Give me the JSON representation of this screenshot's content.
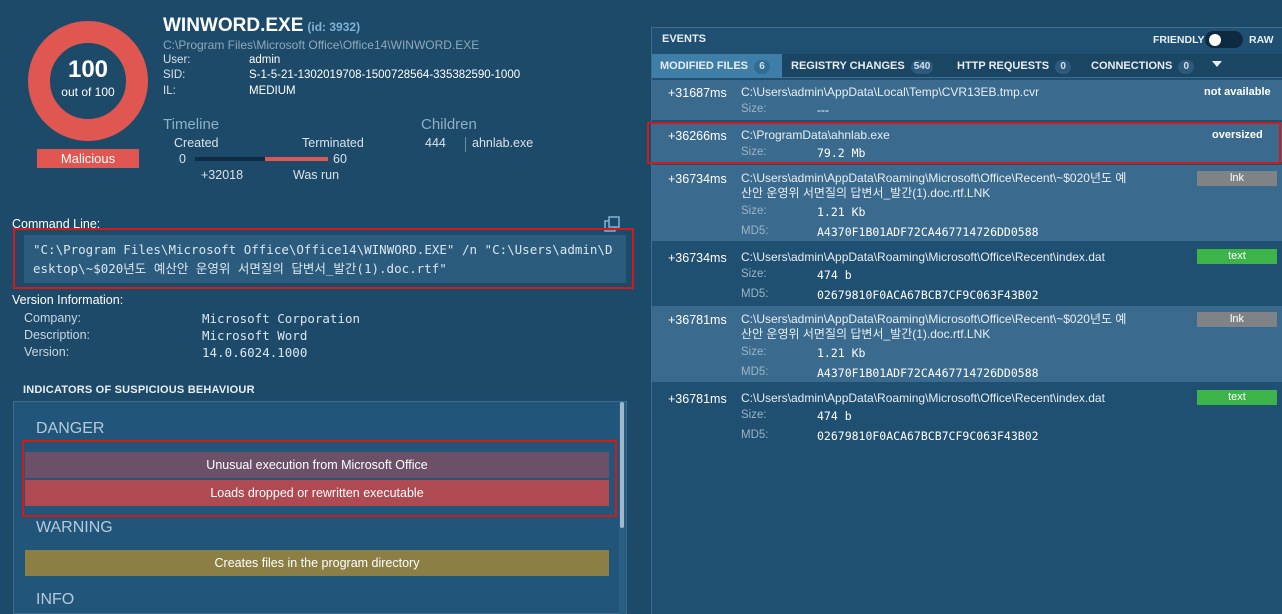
{
  "score": {
    "value": "100",
    "sub": "out of 100",
    "verdict": "Malicious",
    "ring_color": "#e05650",
    "fraction": 1.0
  },
  "process": {
    "name": "WINWORD.EXE",
    "id": "(id: 3932)",
    "path": "C:\\Program Files\\Microsoft Office\\Office14\\WINWORD.EXE",
    "fields": [
      {
        "k": "User:",
        "v": "admin"
      },
      {
        "k": "SID:",
        "v": "S-1-5-21-1302019708-1500728564-335382590-1000"
      },
      {
        "k": "IL:",
        "v": "MEDIUM"
      }
    ]
  },
  "timeline": {
    "title": "Timeline",
    "created_label": "Created",
    "terminated_label": "Terminated",
    "start": "0",
    "end": "60",
    "offset": "+32018",
    "status": "Was run"
  },
  "children": {
    "title": "Children",
    "count": "444",
    "name": "ahnlab.exe"
  },
  "command": {
    "label": "Command Line:",
    "text": "\"C:\\Program Files\\Microsoft Office\\Office14\\WINWORD.EXE\" /n \"C:\\Users\\admin\\Desktop\\~$020년도 예산안 운영위 서면질의 답변서_발간(1).doc.rtf\""
  },
  "version": {
    "title": "Version Information:",
    "rows": [
      {
        "k": "Company:",
        "v": "Microsoft Corporation"
      },
      {
        "k": "Description:",
        "v": "Microsoft Word"
      },
      {
        "k": "Version:",
        "v": "14.0.6024.1000"
      }
    ]
  },
  "indicators": {
    "title": "INDICATORS OF SUSPICIOUS BEHAVIOUR",
    "danger_label": "DANGER",
    "danger": [
      "Unusual execution from Microsoft Office",
      "Loads dropped or rewritten executable"
    ],
    "warning_label": "WARNING",
    "warning": [
      "Creates files in the program directory"
    ],
    "info_label": "INFO",
    "colors": {
      "danger1": "#6b5068",
      "danger2": "#b04a52",
      "warning": "#8c7f46"
    }
  },
  "events": {
    "title": "EVENTS",
    "friendly": "FRIENDLY",
    "raw": "RAW",
    "tabs": [
      {
        "label": "MODIFIED FILES",
        "count": "6"
      },
      {
        "label": "REGISTRY CHANGES",
        "count": "540"
      },
      {
        "label": "HTTP REQUESTS",
        "count": "0"
      },
      {
        "label": "CONNECTIONS",
        "count": "0"
      }
    ],
    "size_label": "Size:",
    "md5_label": "MD5:",
    "rows": [
      {
        "time": "+31687ms",
        "path": "C:\\Users\\admin\\AppData\\Local\\Temp\\CVR13EB.tmp.cvr",
        "size": "---",
        "status": "not available"
      },
      {
        "time": "+36266ms",
        "path": "C:\\ProgramData\\ahnlab.exe",
        "size": "79.2 Mb",
        "status": "oversized"
      },
      {
        "time": "+36734ms",
        "path1": "C:\\Users\\admin\\AppData\\Roaming\\Microsoft\\Office\\Recent\\~$020년도 예",
        "path2": "산안 운영위 서면질의 답변서_발간(1).doc.rtf.LNK",
        "size": "1.21 Kb",
        "md5": "A4370F1B01ADF72CA467714726DD0588",
        "type": "lnk"
      },
      {
        "time": "+36734ms",
        "path": "C:\\Users\\admin\\AppData\\Roaming\\Microsoft\\Office\\Recent\\index.dat",
        "size": "474 b",
        "md5": "02679810F0ACA67BCB7CF9C063F43B02",
        "type": "text"
      },
      {
        "time": "+36781ms",
        "path1": "C:\\Users\\admin\\AppData\\Roaming\\Microsoft\\Office\\Recent\\~$020년도 예",
        "path2": "산안 운영위 서면질의 답변서_발간(1).doc.rtf.LNK",
        "size": "1.21 Kb",
        "md5": "A4370F1B01ADF72CA467714726DD0588",
        "type": "lnk"
      },
      {
        "time": "+36781ms",
        "path": "C:\\Users\\admin\\AppData\\Roaming\\Microsoft\\Office\\Recent\\index.dat",
        "size": "474 b",
        "md5": "02679810F0ACA67BCB7CF9C063F43B02",
        "type": "text"
      }
    ]
  }
}
